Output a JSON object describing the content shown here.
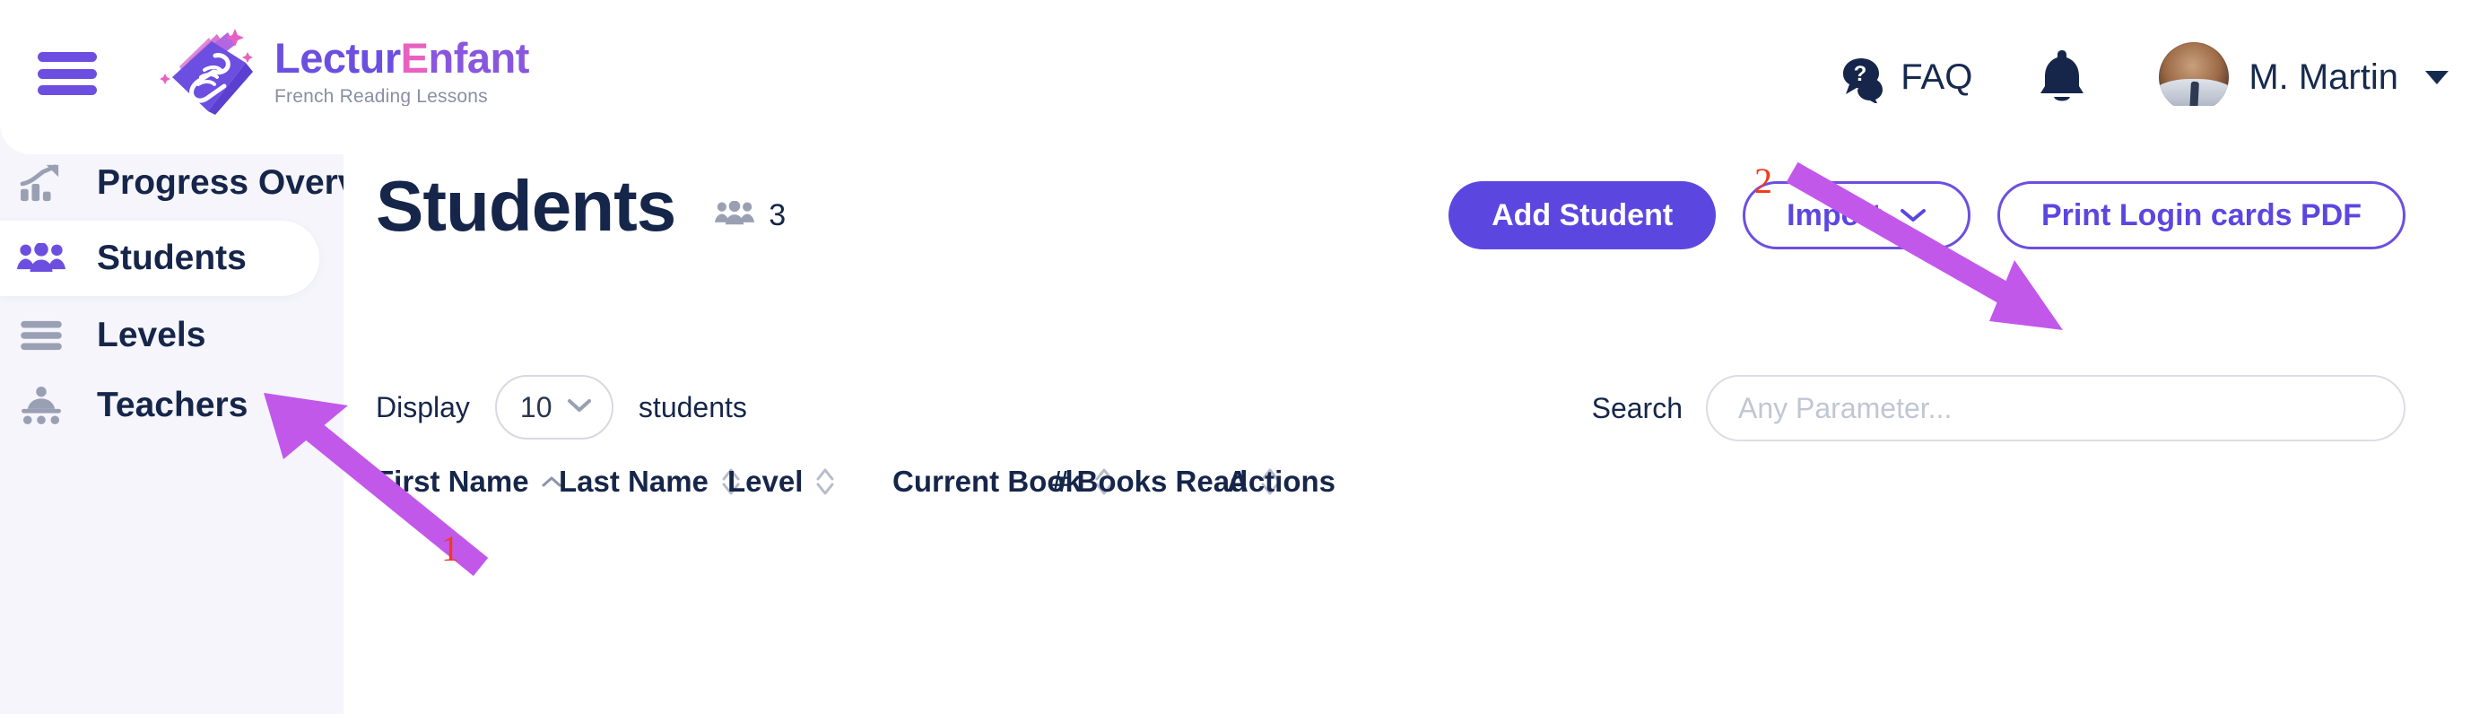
{
  "brand": {
    "name_part1": "Lectur",
    "name_highlight": "E",
    "name_part2": "nfant",
    "tagline": "French Reading Lessons",
    "logo_icon": "open-book-hand-icon",
    "menu_icon": "hamburger-menu-icon"
  },
  "header": {
    "faq_label": "FAQ",
    "faq_icon": "question-chat-icon",
    "notifications_icon": "bell-icon",
    "user_name": "M. Martin",
    "user_avatar_icon": "avatar",
    "user_caret_icon": "chevron-down-icon"
  },
  "sidebar": {
    "items": [
      {
        "label": "Progress Overview",
        "icon": "chart-trend-up-icon",
        "active": false
      },
      {
        "label": "Students",
        "icon": "users-group-icon",
        "active": true
      },
      {
        "label": "Levels",
        "icon": "list-bars-icon",
        "active": false
      },
      {
        "label": "Teachers",
        "icon": "teachers-group-icon",
        "active": false
      }
    ]
  },
  "main": {
    "page_title": "Students",
    "count_icon": "users-group-icon",
    "count": "3",
    "buttons": {
      "add_student": "Add Student",
      "import": "Import",
      "import_caret": "chevron-down-icon",
      "print_login_cards": "Print Login cards PDF"
    },
    "display": {
      "prefix_label": "Display",
      "value": "10",
      "suffix_label": "students",
      "caret_icon": "chevron-down-icon"
    },
    "search": {
      "label": "Search",
      "value": "",
      "placeholder": "Any Parameter..."
    },
    "table": {
      "columns": [
        {
          "label": "First Name",
          "sort": "asc"
        },
        {
          "label": "Last Name",
          "sort": "none"
        },
        {
          "label": "Level",
          "sort": "none"
        },
        {
          "label": "Current Book",
          "sort": "none"
        },
        {
          "label": "# Books Read",
          "sort": "none"
        },
        {
          "label": "Actions",
          "sort": null
        }
      ]
    }
  },
  "annotations": [
    {
      "number": "1",
      "target": "sidebar-item-students"
    },
    {
      "number": "2",
      "target": "print-login-cards-button"
    }
  ],
  "colors": {
    "primary": "#5b47e0",
    "primary_light": "#6c4fe0",
    "accent_pink": "#e861c0",
    "text_dark": "#16264a",
    "page_bg": "#f5f5fb",
    "annotation_arrow": "#c258ea",
    "annotation_number": "#f03c1e"
  }
}
